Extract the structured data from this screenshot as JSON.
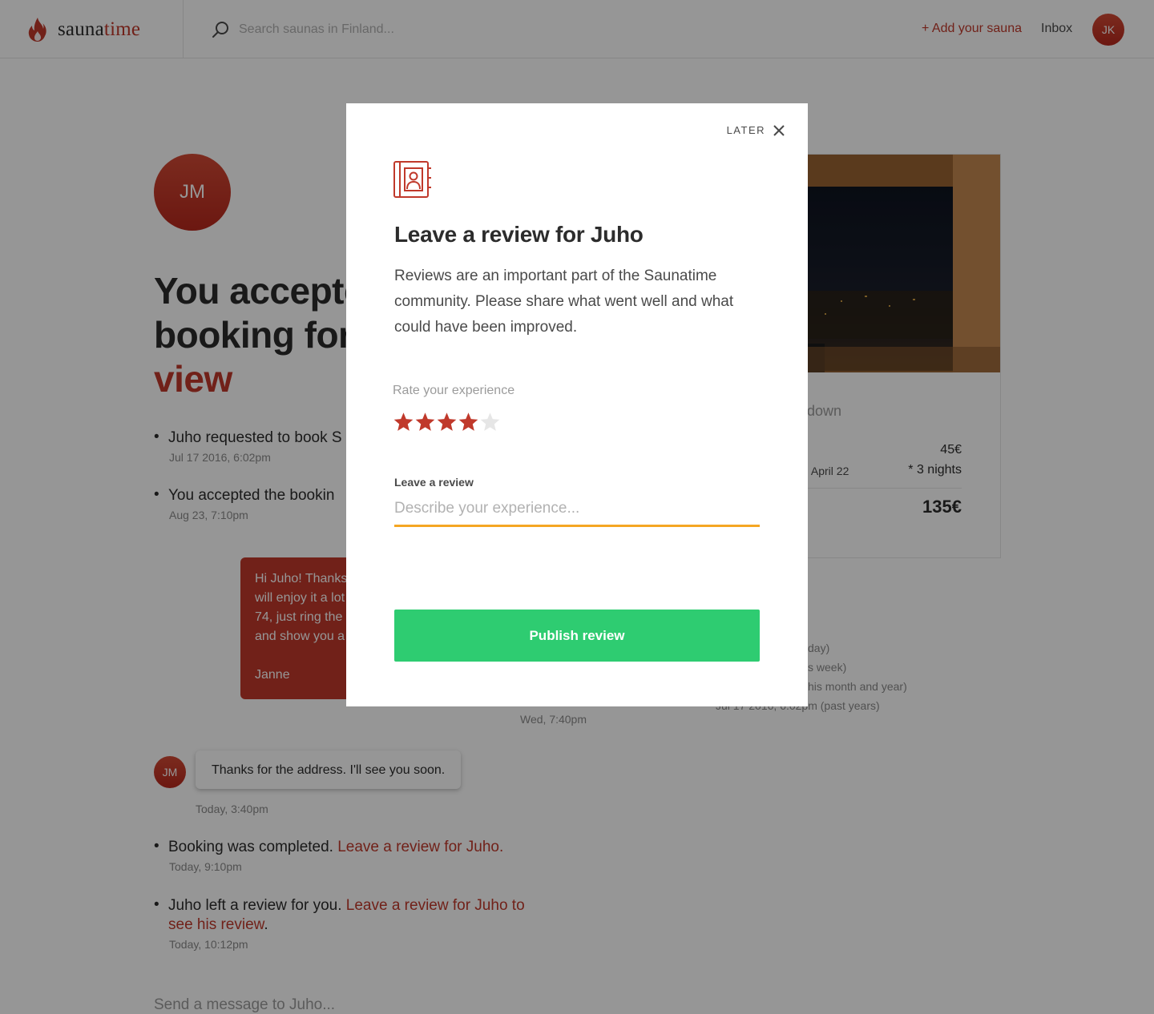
{
  "topbar": {
    "logo_part1": "sauna",
    "logo_part2": "time",
    "search_placeholder": "Search saunas in Finland...",
    "add_sauna": "+ Add your sauna",
    "inbox": "Inbox",
    "user_initials": "JK"
  },
  "page": {
    "guest_initials": "JM",
    "heading_line1": "You accepte",
    "heading_line2": "booking for",
    "heading_link": "view",
    "events": [
      {
        "text": "Juho requested to book S",
        "time": "Jul 17 2016, 6:02pm"
      },
      {
        "text": "You accepted the bookin",
        "time": "Aug 23, 7:10pm"
      }
    ],
    "host_message": {
      "lines": [
        "Hi Juho! Thanks",
        "will enjoy it a lot",
        "74, just ring the",
        "and show you a"
      ],
      "signature": "Janne",
      "time": "Wed, 7:40pm"
    },
    "guest_message": {
      "initials": "JM",
      "text": "Thanks for the address. I'll see you soon.",
      "time": "Today, 3:40pm"
    },
    "completed_event": {
      "text": "Booking was completed. ",
      "link": "Leave a review for Juho.",
      "time": "Today, 9:10pm"
    },
    "review_event": {
      "text": "Juho left a review for you. ",
      "link_line1": "Leave a review for Juho to",
      "link_line2": "see his review",
      "suffix": ".",
      "time": "Today, 10:12pm"
    },
    "send_placeholder": "Send a message to Juho..."
  },
  "card": {
    "breakdown": "down",
    "price_per_night": "45€",
    "date_fragment": "t, April 22",
    "nights": "* 3 nights",
    "total": "135€",
    "side_list": [
      "day)",
      "s week)",
      "his month and year)",
      "Jul 17 2016, 6:02pm (past years)"
    ]
  },
  "modal": {
    "later": "LATER",
    "title": "Leave a review for Juho",
    "description": "Reviews are an important part of the Saunatime community. Please share what went well and what could have been improved.",
    "rate_label": "Rate your experience",
    "rating": 4,
    "max_rating": 5,
    "review_label": "Leave a review",
    "review_placeholder": "Describe your experience...",
    "publish_label": "Publish review"
  },
  "colors": {
    "brand_red": "#c0392b",
    "publish_green": "#2ecc71",
    "input_underline": "#f5a623",
    "star_empty": "#e6e6e6"
  }
}
